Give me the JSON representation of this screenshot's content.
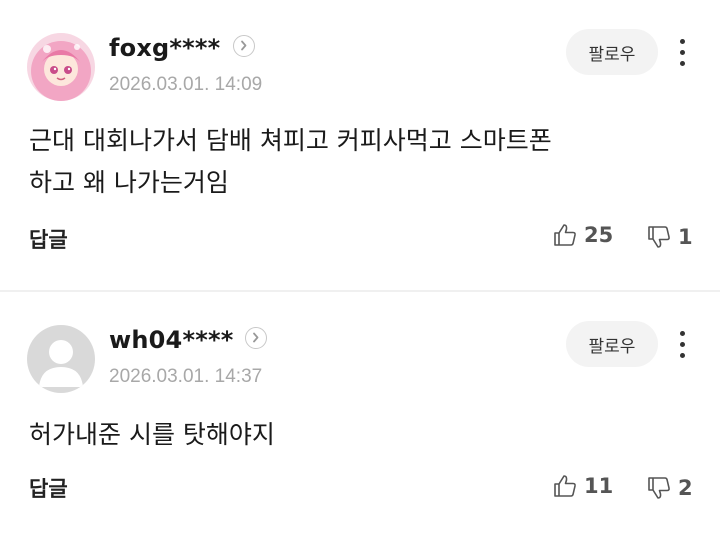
{
  "comments": [
    {
      "nickname": "foxg****",
      "date": "2026.03.01. 14:09",
      "follow_label": "팔로우",
      "text_lines": [
        "근대 대회나가서 담배 쳐피고 커피사먹고 스마트폰",
        "하고 왜 나가는거임"
      ],
      "reply_label": "답글",
      "likes": "25",
      "dislikes": "1",
      "avatar": "anime-character-avatar"
    },
    {
      "nickname": "wh04****",
      "date": "2026.03.01. 14:37",
      "follow_label": "팔로우",
      "text_lines": [
        "허가내준 시를 탓해야지"
      ],
      "reply_label": "답글",
      "likes": "11",
      "dislikes": "2",
      "avatar": "default-user-avatar"
    }
  ],
  "colors": {
    "date": "#a8a8a8",
    "follow_bg": "#f3f3f3",
    "divider": "#f0f0f0"
  }
}
